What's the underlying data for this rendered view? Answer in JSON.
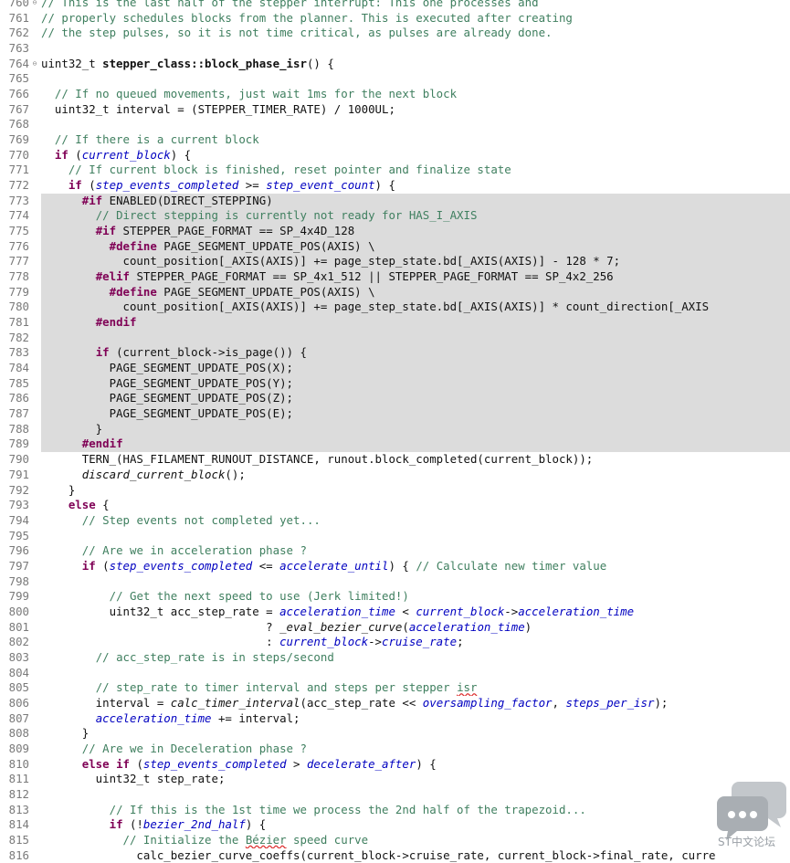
{
  "editor": {
    "language": "cpp",
    "highlight_color": "#dcdcdc",
    "colors": {
      "comment": "#3f7f5f",
      "keyword": "#7f0055",
      "field": "#0000c0",
      "line_number": "#7a7a7a"
    },
    "lines": [
      {
        "n": "760",
        "fold": true,
        "seg": [
          [
            "cm",
            "// This is the last half of the stepper interrupt: This one processes and"
          ]
        ]
      },
      {
        "n": "761",
        "seg": [
          [
            "cm",
            "// properly schedules blocks from the planner. This is executed after creating"
          ]
        ]
      },
      {
        "n": "762",
        "seg": [
          [
            "cm",
            "// the step pulses, so it is not time critical, as pulses are already done."
          ]
        ]
      },
      {
        "n": "763",
        "seg": []
      },
      {
        "n": "764",
        "fold": true,
        "seg": [
          [
            "",
            "uint32_t "
          ],
          [
            "bold",
            "stepper_class::block_phase_isr"
          ],
          [
            "",
            "() {"
          ]
        ]
      },
      {
        "n": "765",
        "seg": []
      },
      {
        "n": "766",
        "seg": [
          [
            "",
            "  "
          ],
          [
            "cm",
            "// If no queued movements, just wait 1ms for the next block"
          ]
        ]
      },
      {
        "n": "767",
        "seg": [
          [
            "",
            "  uint32_t interval = (STEPPER_TIMER_RATE) / 1000UL;"
          ]
        ]
      },
      {
        "n": "768",
        "seg": []
      },
      {
        "n": "769",
        "seg": [
          [
            "",
            "  "
          ],
          [
            "cm",
            "// If there is a current block"
          ]
        ]
      },
      {
        "n": "770",
        "seg": [
          [
            "",
            "  "
          ],
          [
            "kw",
            "if"
          ],
          [
            "",
            " ("
          ],
          [
            "it",
            "current_block"
          ],
          [
            "",
            ") {"
          ]
        ]
      },
      {
        "n": "771",
        "seg": [
          [
            "",
            "    "
          ],
          [
            "cm",
            "// If current block is finished, reset pointer and finalize state"
          ]
        ]
      },
      {
        "n": "772",
        "seg": [
          [
            "",
            "    "
          ],
          [
            "kw",
            "if"
          ],
          [
            "",
            " ("
          ],
          [
            "it",
            "step_events_completed"
          ],
          [
            "",
            " >= "
          ],
          [
            "it",
            "step_event_count"
          ],
          [
            "",
            ") {"
          ]
        ]
      },
      {
        "n": "773",
        "hl": true,
        "seg": [
          [
            "",
            "      "
          ],
          [
            "kw",
            "#if"
          ],
          [
            "",
            " ENABLED(DIRECT_STEPPING)"
          ]
        ]
      },
      {
        "n": "774",
        "hl": true,
        "seg": [
          [
            "",
            "        "
          ],
          [
            "cm",
            "// Direct stepping is currently not ready for HAS_I_AXIS"
          ]
        ]
      },
      {
        "n": "775",
        "hl": true,
        "seg": [
          [
            "",
            "        "
          ],
          [
            "kw",
            "#if"
          ],
          [
            "",
            " STEPPER_PAGE_FORMAT == SP_4x4D_128"
          ]
        ]
      },
      {
        "n": "776",
        "hl": true,
        "seg": [
          [
            "",
            "          "
          ],
          [
            "kw",
            "#define"
          ],
          [
            "",
            " PAGE_SEGMENT_UPDATE_POS(AXIS) \\"
          ]
        ]
      },
      {
        "n": "777",
        "hl": true,
        "seg": [
          [
            "",
            "            count_position[_AXIS(AXIS)] += page_step_state.bd[_AXIS(AXIS)] - 128 * 7;"
          ]
        ]
      },
      {
        "n": "778",
        "hl": true,
        "seg": [
          [
            "",
            "        "
          ],
          [
            "kw",
            "#elif"
          ],
          [
            "",
            " STEPPER_PAGE_FORMAT == SP_4x1_512 || STEPPER_PAGE_FORMAT == SP_4x2_256"
          ]
        ]
      },
      {
        "n": "779",
        "hl": true,
        "seg": [
          [
            "",
            "          "
          ],
          [
            "kw",
            "#define"
          ],
          [
            "",
            " PAGE_SEGMENT_UPDATE_POS(AXIS) \\"
          ]
        ]
      },
      {
        "n": "780",
        "hl": true,
        "seg": [
          [
            "",
            "            count_position[_AXIS(AXIS)] += page_step_state.bd[_AXIS(AXIS)] * count_direction[_AXIS"
          ]
        ]
      },
      {
        "n": "781",
        "hl": true,
        "seg": [
          [
            "",
            "        "
          ],
          [
            "kw",
            "#endif"
          ]
        ]
      },
      {
        "n": "782",
        "hl": true,
        "seg": []
      },
      {
        "n": "783",
        "hl": true,
        "seg": [
          [
            "",
            "        "
          ],
          [
            "kw",
            "if"
          ],
          [
            "",
            " (current_block->is_page()) {"
          ]
        ]
      },
      {
        "n": "784",
        "hl": true,
        "seg": [
          [
            "",
            "          PAGE_SEGMENT_UPDATE_POS(X);"
          ]
        ]
      },
      {
        "n": "785",
        "hl": true,
        "seg": [
          [
            "",
            "          PAGE_SEGMENT_UPDATE_POS(Y);"
          ]
        ]
      },
      {
        "n": "786",
        "hl": true,
        "seg": [
          [
            "",
            "          PAGE_SEGMENT_UPDATE_POS(Z);"
          ]
        ]
      },
      {
        "n": "787",
        "hl": true,
        "seg": [
          [
            "",
            "          PAGE_SEGMENT_UPDATE_POS(E);"
          ]
        ]
      },
      {
        "n": "788",
        "hl": true,
        "seg": [
          [
            "",
            "        }"
          ]
        ]
      },
      {
        "n": "789",
        "hl": true,
        "seg": [
          [
            "",
            "      "
          ],
          [
            "kw",
            "#endif"
          ]
        ]
      },
      {
        "n": "790",
        "seg": [
          [
            "",
            "      TERN_(HAS_FILAMENT_RUNOUT_DISTANCE, runout.block_completed(current_block));"
          ]
        ]
      },
      {
        "n": "791",
        "seg": [
          [
            "",
            "      "
          ],
          [
            "fn",
            "discard_current_block"
          ],
          [
            "",
            "();"
          ]
        ]
      },
      {
        "n": "792",
        "seg": [
          [
            "",
            "    }"
          ]
        ]
      },
      {
        "n": "793",
        "seg": [
          [
            "",
            "    "
          ],
          [
            "kw",
            "else"
          ],
          [
            "",
            " {"
          ]
        ]
      },
      {
        "n": "794",
        "seg": [
          [
            "",
            "      "
          ],
          [
            "cm",
            "// Step events not completed yet..."
          ]
        ]
      },
      {
        "n": "795",
        "seg": []
      },
      {
        "n": "796",
        "seg": [
          [
            "",
            "      "
          ],
          [
            "cm",
            "// Are we in acceleration phase ?"
          ]
        ]
      },
      {
        "n": "797",
        "seg": [
          [
            "",
            "      "
          ],
          [
            "kw",
            "if"
          ],
          [
            "",
            " ("
          ],
          [
            "it",
            "step_events_completed"
          ],
          [
            "",
            " <= "
          ],
          [
            "it",
            "accelerate_until"
          ],
          [
            "",
            ") { "
          ],
          [
            "cm",
            "// Calculate new timer value"
          ]
        ]
      },
      {
        "n": "798",
        "seg": []
      },
      {
        "n": "799",
        "seg": [
          [
            "",
            "          "
          ],
          [
            "cm",
            "// Get the next speed to use (Jerk limited!)"
          ]
        ]
      },
      {
        "n": "800",
        "seg": [
          [
            "",
            "          uint32_t acc_step_rate = "
          ],
          [
            "it",
            "acceleration_time"
          ],
          [
            "",
            " < "
          ],
          [
            "it",
            "current_block"
          ],
          [
            "",
            "->"
          ],
          [
            "it",
            "acceleration_time"
          ]
        ]
      },
      {
        "n": "801",
        "seg": [
          [
            "",
            "                                 ? "
          ],
          [
            "fn",
            "_eval_bezier_curve"
          ],
          [
            "",
            "("
          ],
          [
            "it",
            "acceleration_time"
          ],
          [
            "",
            ")"
          ]
        ]
      },
      {
        "n": "802",
        "seg": [
          [
            "",
            "                                 : "
          ],
          [
            "it",
            "current_block"
          ],
          [
            "",
            "->"
          ],
          [
            "it",
            "cruise_rate"
          ],
          [
            "",
            ";"
          ]
        ]
      },
      {
        "n": "803",
        "seg": [
          [
            "",
            "        "
          ],
          [
            "cm",
            "// acc_step_rate is in steps/second"
          ]
        ]
      },
      {
        "n": "804",
        "seg": []
      },
      {
        "n": "805",
        "seg": [
          [
            "",
            "        "
          ],
          [
            "cm",
            "// step_rate to timer interval and steps per stepper "
          ],
          [
            "cm squig",
            "isr"
          ]
        ]
      },
      {
        "n": "806",
        "seg": [
          [
            "",
            "        interval = "
          ],
          [
            "fn",
            "calc_timer_interval"
          ],
          [
            "",
            "(acc_step_rate << "
          ],
          [
            "it",
            "oversampling_factor"
          ],
          [
            "",
            ", "
          ],
          [
            "it",
            "steps_per_isr"
          ],
          [
            "",
            ");"
          ]
        ]
      },
      {
        "n": "807",
        "seg": [
          [
            "",
            "        "
          ],
          [
            "it",
            "acceleration_time"
          ],
          [
            "",
            " += interval;"
          ]
        ]
      },
      {
        "n": "808",
        "seg": [
          [
            "",
            "      }"
          ]
        ]
      },
      {
        "n": "809",
        "seg": [
          [
            "",
            "      "
          ],
          [
            "cm",
            "// Are we in Deceleration phase ?"
          ]
        ]
      },
      {
        "n": "810",
        "seg": [
          [
            "",
            "      "
          ],
          [
            "kw",
            "else if"
          ],
          [
            "",
            " ("
          ],
          [
            "it",
            "step_events_completed"
          ],
          [
            "",
            " > "
          ],
          [
            "it",
            "decelerate_after"
          ],
          [
            "",
            ") {"
          ]
        ]
      },
      {
        "n": "811",
        "seg": [
          [
            "",
            "        uint32_t step_rate;"
          ]
        ]
      },
      {
        "n": "812",
        "seg": []
      },
      {
        "n": "813",
        "seg": [
          [
            "",
            "          "
          ],
          [
            "cm",
            "// If this is the 1st time we process the 2nd half of the trapezoid..."
          ]
        ]
      },
      {
        "n": "814",
        "seg": [
          [
            "",
            "          "
          ],
          [
            "kw",
            "if"
          ],
          [
            "",
            " (!"
          ],
          [
            "it",
            "bezier_2nd_half"
          ],
          [
            "",
            ") {"
          ]
        ]
      },
      {
        "n": "815",
        "seg": [
          [
            "",
            "            "
          ],
          [
            "cm",
            "// Initialize the "
          ],
          [
            "cm squig",
            "Bézier"
          ],
          [
            "cm",
            " speed curve"
          ]
        ]
      },
      {
        "n": "816",
        "seg": [
          [
            "",
            "              calc_bezier_curve_coeffs(current_block->cruise_rate, current_block->final_rate, curre"
          ]
        ]
      }
    ]
  },
  "watermark": {
    "text": "ST中文论坛",
    "icon": "chat-bubbles-icon",
    "color": "#c3c7cb"
  }
}
